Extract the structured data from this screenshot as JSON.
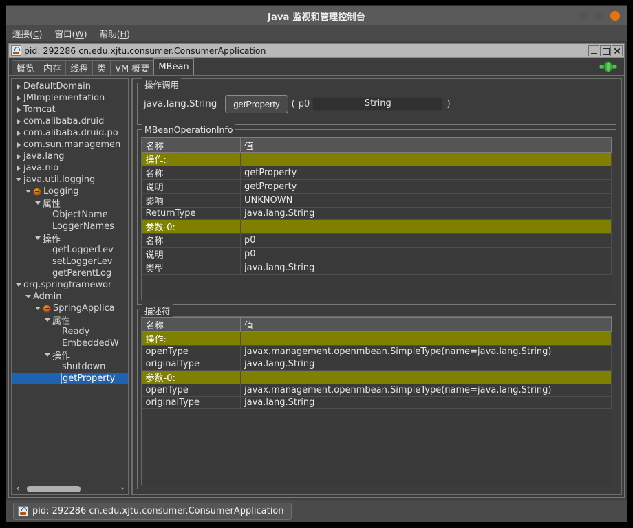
{
  "window": {
    "title": "Java 监视和管理控制台",
    "controls": [
      "minimize-dot",
      "maximize-dot",
      "close-dot"
    ]
  },
  "menubar": {
    "items": [
      {
        "name": "connection",
        "prefix": "连接(",
        "mnemonic": "C",
        "suffix": ")"
      },
      {
        "name": "window",
        "prefix": "窗口(",
        "mnemonic": "W",
        "suffix": ")"
      },
      {
        "name": "help",
        "prefix": "帮助(",
        "mnemonic": "H",
        "suffix": ")"
      }
    ]
  },
  "internal_frame": {
    "icon": "java-coffee-icon",
    "title": "pid: 292286 cn.edu.xjtu.consumer.ConsumerApplication",
    "buttons": [
      "minimize-button",
      "maximize-button",
      "close-button"
    ]
  },
  "tabs": {
    "items": [
      {
        "label": "概览",
        "active": false
      },
      {
        "label": "内存",
        "active": false
      },
      {
        "label": "线程",
        "active": false
      },
      {
        "label": "类",
        "active": false
      },
      {
        "label": "VM 概要",
        "active": false
      },
      {
        "label": "MBean",
        "active": true
      }
    ],
    "connection_indicator": "connected-plug-icon"
  },
  "tree": {
    "nodes": [
      {
        "label": "DefaultDomain",
        "indent": 0,
        "twist": "right",
        "icon": "none",
        "selected": false
      },
      {
        "label": "JMImplementation",
        "indent": 0,
        "twist": "right",
        "icon": "none",
        "selected": false
      },
      {
        "label": "Tomcat",
        "indent": 0,
        "twist": "right",
        "icon": "none",
        "selected": false
      },
      {
        "label": "com.alibaba.druid",
        "indent": 0,
        "twist": "right",
        "icon": "none",
        "selected": false
      },
      {
        "label": "com.alibaba.druid.po",
        "indent": 0,
        "twist": "right",
        "icon": "none",
        "selected": false
      },
      {
        "label": "com.sun.managemen",
        "indent": 0,
        "twist": "right",
        "icon": "none",
        "selected": false
      },
      {
        "label": "java.lang",
        "indent": 0,
        "twist": "right",
        "icon": "none",
        "selected": false
      },
      {
        "label": "java.nio",
        "indent": 0,
        "twist": "right",
        "icon": "none",
        "selected": false
      },
      {
        "label": "java.util.logging",
        "indent": 0,
        "twist": "down",
        "icon": "none",
        "selected": false
      },
      {
        "label": "Logging",
        "indent": 1,
        "twist": "down",
        "icon": "mbean",
        "selected": false
      },
      {
        "label": "属性",
        "indent": 2,
        "twist": "down",
        "icon": "none",
        "selected": false
      },
      {
        "label": "ObjectName",
        "indent": 3,
        "twist": "none",
        "icon": "none",
        "selected": false
      },
      {
        "label": "LoggerNames",
        "indent": 3,
        "twist": "none",
        "icon": "none",
        "selected": false
      },
      {
        "label": "操作",
        "indent": 2,
        "twist": "down",
        "icon": "none",
        "selected": false
      },
      {
        "label": "getLoggerLev",
        "indent": 3,
        "twist": "none",
        "icon": "none",
        "selected": false
      },
      {
        "label": "setLoggerLev",
        "indent": 3,
        "twist": "none",
        "icon": "none",
        "selected": false
      },
      {
        "label": "getParentLog",
        "indent": 3,
        "twist": "none",
        "icon": "none",
        "selected": false
      },
      {
        "label": "org.springframewor",
        "indent": 0,
        "twist": "down",
        "icon": "none",
        "selected": false
      },
      {
        "label": "Admin",
        "indent": 1,
        "twist": "down",
        "icon": "none",
        "selected": false
      },
      {
        "label": "SpringApplica",
        "indent": 2,
        "twist": "down",
        "icon": "mbean",
        "selected": false
      },
      {
        "label": "属性",
        "indent": 3,
        "twist": "down",
        "icon": "none",
        "selected": false
      },
      {
        "label": "Ready",
        "indent": 4,
        "twist": "none",
        "icon": "none",
        "selected": false
      },
      {
        "label": "EmbeddedW",
        "indent": 4,
        "twist": "none",
        "icon": "none",
        "selected": false
      },
      {
        "label": "操作",
        "indent": 3,
        "twist": "down",
        "icon": "none",
        "selected": false
      },
      {
        "label": "shutdown",
        "indent": 4,
        "twist": "none",
        "icon": "none",
        "selected": false
      },
      {
        "label": "getProperty",
        "indent": 4,
        "twist": "none",
        "icon": "none",
        "selected": true
      }
    ],
    "hscrollbar": {
      "left_arrow": "‹",
      "right_arrow": "›"
    }
  },
  "operation_invocation": {
    "legend": "操作调用",
    "return_type": "java.lang.String",
    "button_label": "getProperty",
    "open_paren": "(",
    "close_paren": ")",
    "param_name": "p0",
    "param_placeholder": "String",
    "param_value": ""
  },
  "mbean_operation_info": {
    "legend": "MBeanOperationInfo",
    "columns": [
      "名称",
      "值"
    ],
    "rows": [
      {
        "section": true,
        "name": "操作:",
        "value": ""
      },
      {
        "section": false,
        "name": "名称",
        "value": "getProperty"
      },
      {
        "section": false,
        "name": "说明",
        "value": "getProperty"
      },
      {
        "section": false,
        "name": "影响",
        "value": "UNKNOWN"
      },
      {
        "section": false,
        "name": "ReturnType",
        "value": "java.lang.String"
      },
      {
        "section": true,
        "name": "参数-0:",
        "value": ""
      },
      {
        "section": false,
        "name": "名称",
        "value": "p0"
      },
      {
        "section": false,
        "name": "说明",
        "value": "p0"
      },
      {
        "section": false,
        "name": "类型",
        "value": "java.lang.String"
      }
    ]
  },
  "descriptor": {
    "legend": "描述符",
    "columns": [
      "名称",
      "值"
    ],
    "rows": [
      {
        "section": true,
        "name": "操作:",
        "value": ""
      },
      {
        "section": false,
        "name": "openType",
        "value": "javax.management.openmbean.SimpleType(name=java.lang.String)"
      },
      {
        "section": false,
        "name": "originalType",
        "value": "java.lang.String"
      },
      {
        "section": true,
        "name": "参数-0:",
        "value": ""
      },
      {
        "section": false,
        "name": "openType",
        "value": "javax.management.openmbean.SimpleType(name=java.lang.String)"
      },
      {
        "section": false,
        "name": "originalType",
        "value": "java.lang.String"
      }
    ]
  },
  "statusbar": {
    "icon": "java-coffee-icon",
    "text": "pid: 292286 cn.edu.xjtu.consumer.ConsumerApplication"
  },
  "colors": {
    "window_bg": "#4a4a4a",
    "panel_bg": "#3c3c3c",
    "titlebar_bg": "#5a5a5a",
    "section_highlight": "#808000",
    "selection_blue": "#1f63b0",
    "close_orange": "#e8720c",
    "connected_green": "#3fa83f",
    "text": "#e4e4e4"
  }
}
